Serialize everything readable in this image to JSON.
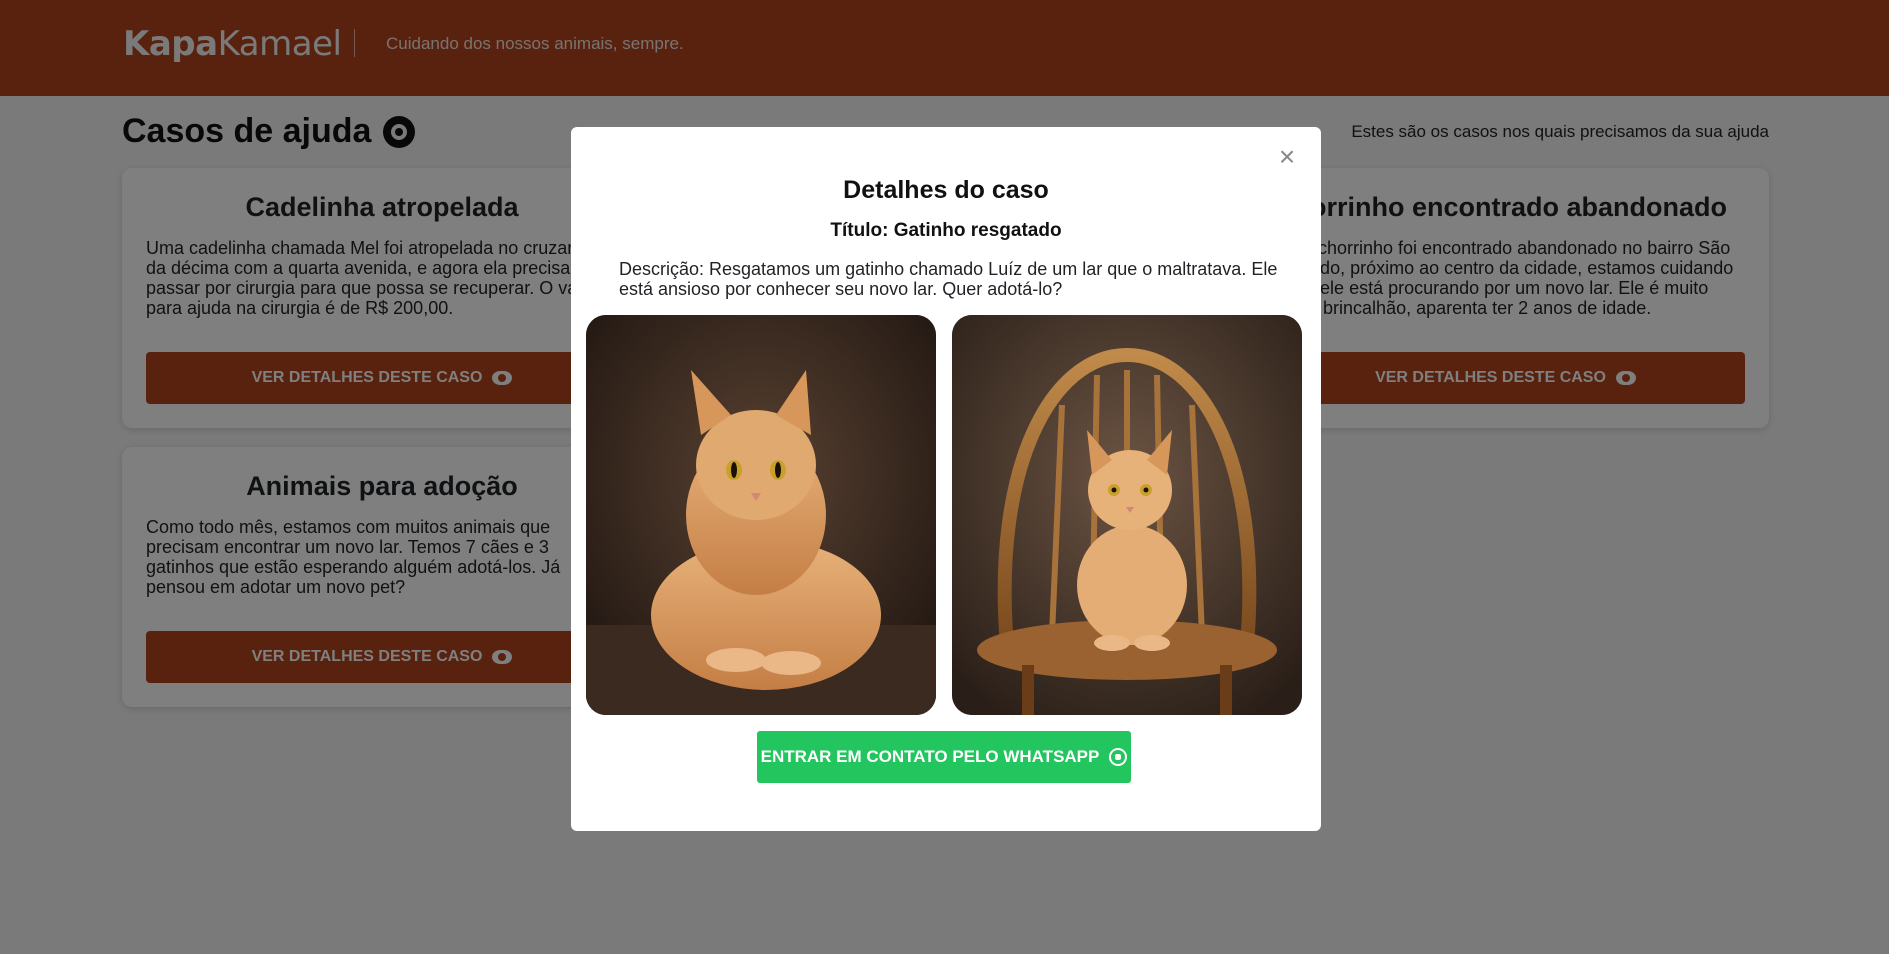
{
  "header": {
    "logo_bold": "Kapa",
    "logo_light": "Kamael",
    "tagline": "Cuidando dos nossos animais, sempre."
  },
  "page": {
    "title": "Casos de ajuda",
    "title_icon": "lifebuoy-icon",
    "subtitle": "Estes são os casos nos quais precisamos da sua ajuda"
  },
  "cards": [
    {
      "title": "Cadelinha atropelada",
      "description": "Uma cadelinha chamada Mel foi atropelada no cruzamento da décima com a quarta avenida, e agora ela precisará passar por cirurgia para que possa se recuperar. O valor para ajuda na cirurgia é de R$ 200,00.",
      "button_label": "VER DETALHES DESTE CASO",
      "button_icon": "eye-icon"
    },
    {
      "title": "Cachorrinho encontrado abandonado",
      "description": "Um cachorrinho foi encontrado abandonado no bairro São Leopoldo, próximo ao centro da cidade, estamos cuidando dele e ele está procurando por um novo lar. Ele é muito dócil e brincalhão, aparenta ter 2 anos de idade.",
      "button_label": "VER DETALHES DESTE CASO",
      "button_icon": "eye-icon"
    },
    {
      "title": "Animais para adoção",
      "description": "Como todo mês, estamos com muitos animais que precisam encontrar um novo lar. Temos 7 cães e 3 gatinhos que estão esperando alguém adotá-los. Já pensou em adotar um novo pet?",
      "button_label": "VER DETALHES DESTE CASO",
      "button_icon": "eye-icon"
    }
  ],
  "modal": {
    "heading": "Detalhes do caso",
    "case_title": "Título: Gatinho resgatado",
    "description": "Descrição: Resgatamos um gatinho chamado Luíz de um lar que o maltratava. Ele está ansioso por conhecer seu novo lar. Quer adotá-lo?",
    "close_icon": "close-icon",
    "whatsapp_label": "ENTRAR EM CONTATO PELO WHATSAPP",
    "whatsapp_icon": "whatsapp-icon",
    "whatsapp_color": "#22c55e"
  },
  "colors": {
    "brand": "#b3441c",
    "overlay": "rgba(0,0,0,0.5)"
  }
}
